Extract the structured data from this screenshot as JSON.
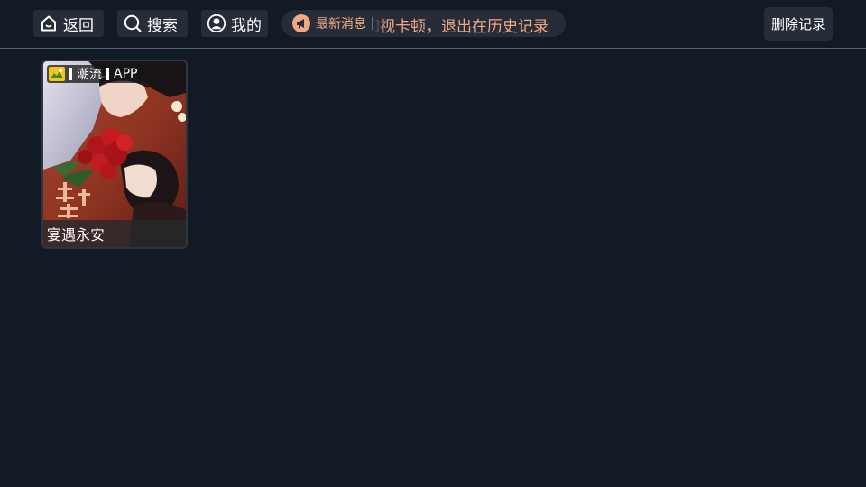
{
  "topbar": {
    "back_label": "返回",
    "search_label": "搜索",
    "mine_label": "我的",
    "notice": {
      "tag": "最新消息",
      "text": "如视卡顿，退出在历史记录"
    },
    "delete_label": "删除记录"
  },
  "history": {
    "items": [
      {
        "badge_source": "潮流",
        "badge_type": "APP",
        "title": "宴遇永安"
      }
    ]
  },
  "colors": {
    "background": "#121a26",
    "button_bg": "#262d38",
    "accent": "#f0a882"
  },
  "icons": {
    "back": "home-icon",
    "search": "search-icon",
    "mine": "user-icon",
    "notice": "megaphone-icon",
    "badge": "app-logo-icon"
  }
}
